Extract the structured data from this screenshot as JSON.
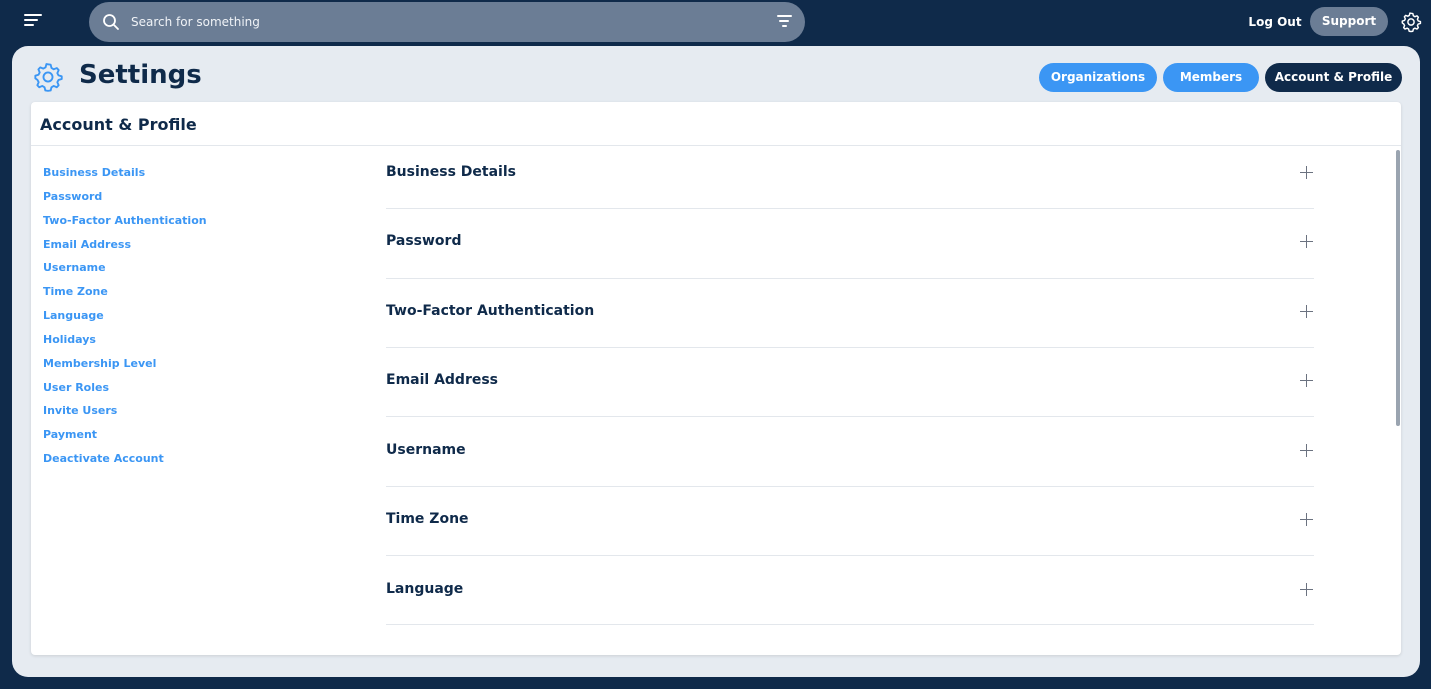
{
  "topbar": {
    "search_placeholder": "Search for something",
    "logout_label": "Log Out",
    "support_label": "Support"
  },
  "header": {
    "title": "Settings",
    "tabs": [
      {
        "label": "Organizations",
        "active": false
      },
      {
        "label": "Members",
        "active": false
      },
      {
        "label": "Account & Profile",
        "active": true
      }
    ]
  },
  "card": {
    "title": "Account & Profile",
    "nav_items": [
      {
        "label": "Business Details"
      },
      {
        "label": "Password"
      },
      {
        "label": "Two-Factor Authentication"
      },
      {
        "label": "Email Address"
      },
      {
        "label": "Username"
      },
      {
        "label": "Time Zone"
      },
      {
        "label": "Language"
      },
      {
        "label": "Holidays"
      },
      {
        "label": "Membership Level"
      },
      {
        "label": "User Roles"
      },
      {
        "label": "Invite Users"
      },
      {
        "label": "Payment"
      },
      {
        "label": "Deactivate Account"
      }
    ],
    "sections": [
      {
        "label": "Business Details"
      },
      {
        "label": "Password"
      },
      {
        "label": "Two-Factor Authentication"
      },
      {
        "label": "Email Address"
      },
      {
        "label": "Username"
      },
      {
        "label": "Time Zone"
      },
      {
        "label": "Language"
      }
    ]
  },
  "colors": {
    "navy": "#0f2a4a",
    "accent_blue": "#3b96f4",
    "search_bg": "#6b7d95",
    "panel_bg": "#e6ebf1"
  }
}
